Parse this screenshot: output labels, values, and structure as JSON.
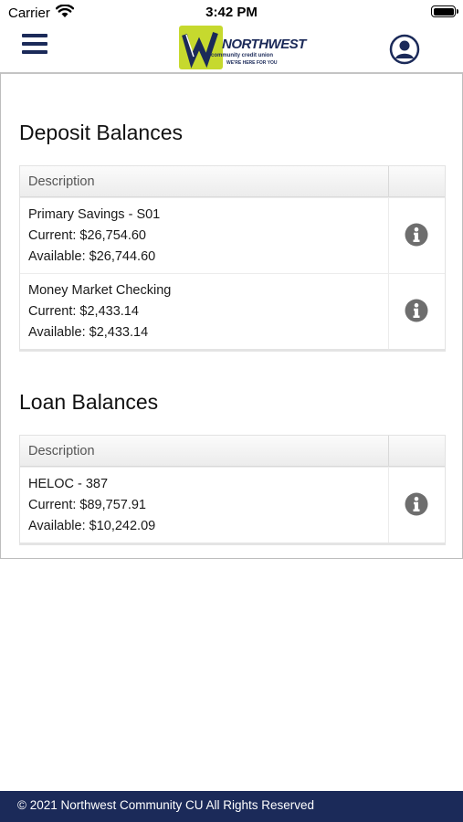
{
  "status_bar": {
    "carrier": "Carrier",
    "time": "3:42 PM"
  },
  "header": {
    "logo_initial": "N",
    "logo_title": "NORTHWEST",
    "logo_subtitle": "community credit union",
    "logo_tagline": "WE'RE HERE FOR YOU",
    "menu_icon": "hamburger-icon",
    "profile_icon": "user-circle-icon",
    "brand_color": "#1b2a59",
    "logo_color": "#c6d92e"
  },
  "deposit": {
    "title": "Deposit Balances",
    "header_description": "Description",
    "rows": [
      {
        "name": "Primary Savings - S01",
        "current": "Current: $26,754.60",
        "available": "Available: $26,744.60"
      },
      {
        "name": "Money Market Checking",
        "current": "Current: $2,433.14",
        "available": "Available: $2,433.14"
      }
    ]
  },
  "loan": {
    "title": "Loan Balances",
    "header_description": "Description",
    "rows": [
      {
        "name": "HELOC - 387",
        "current": "Current: $89,757.91",
        "available": "Available: $10,242.09"
      }
    ]
  },
  "footer": {
    "text": "© 2021 Northwest Community CU All Rights Reserved"
  }
}
